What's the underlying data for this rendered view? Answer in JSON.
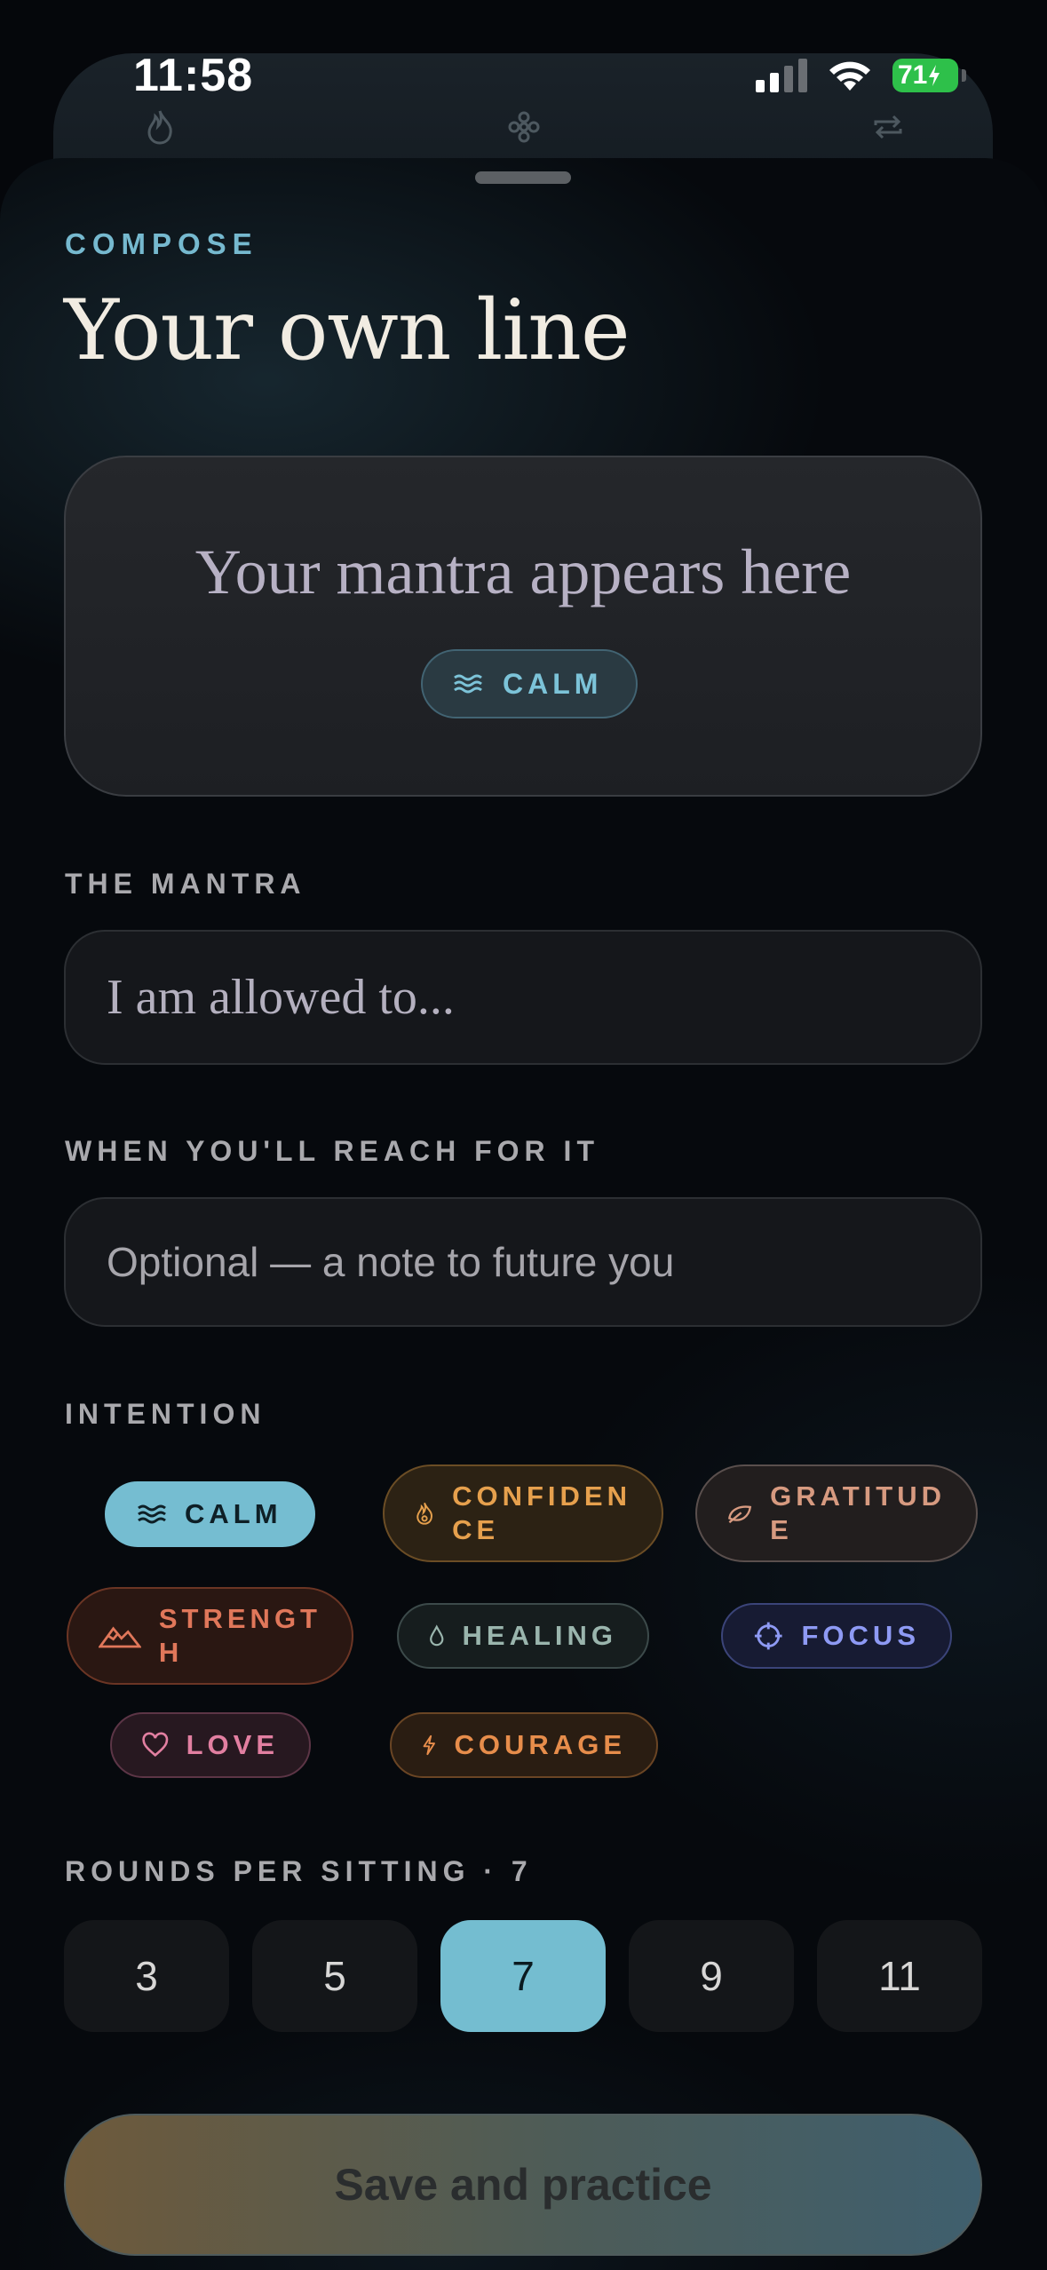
{
  "status_bar": {
    "time": "11:58",
    "battery": "71"
  },
  "tabs": [
    {
      "icon": "flame-icon"
    },
    {
      "icon": "flower-icon"
    },
    {
      "icon": "repeat-icon"
    }
  ],
  "header": {
    "eyebrow": "COMPOSE",
    "title": "Your own line"
  },
  "preview": {
    "text": "Your mantra appears here",
    "chip_label": "CALM"
  },
  "mantra": {
    "label": "THE MANTRA",
    "placeholder": "I am allowed to..."
  },
  "reach": {
    "label": "WHEN YOU'LL REACH FOR IT",
    "placeholder": "Optional — a note to future you"
  },
  "intention": {
    "label": "INTENTION",
    "selected": "CALM",
    "options": [
      {
        "label": "CALM",
        "icon": "waves-icon"
      },
      {
        "label": "CONFIDEN\nCE",
        "icon": "flame-icon"
      },
      {
        "label": "GRATITUD\nE",
        "icon": "leaf-icon"
      },
      {
        "label": "STRENGT\nH",
        "icon": "mountain-icon"
      },
      {
        "label": "HEALING",
        "icon": "drop-icon"
      },
      {
        "label": "FOCUS",
        "icon": "crosshair-icon"
      },
      {
        "label": "LOVE",
        "icon": "heart-icon"
      },
      {
        "label": "COURAGE",
        "icon": "bolt-icon"
      }
    ]
  },
  "rounds": {
    "label": "ROUNDS PER SITTING · 7",
    "options": [
      "3",
      "5",
      "7",
      "9",
      "11"
    ],
    "selected": "7"
  },
  "save_button": {
    "label": "Save and practice"
  }
}
